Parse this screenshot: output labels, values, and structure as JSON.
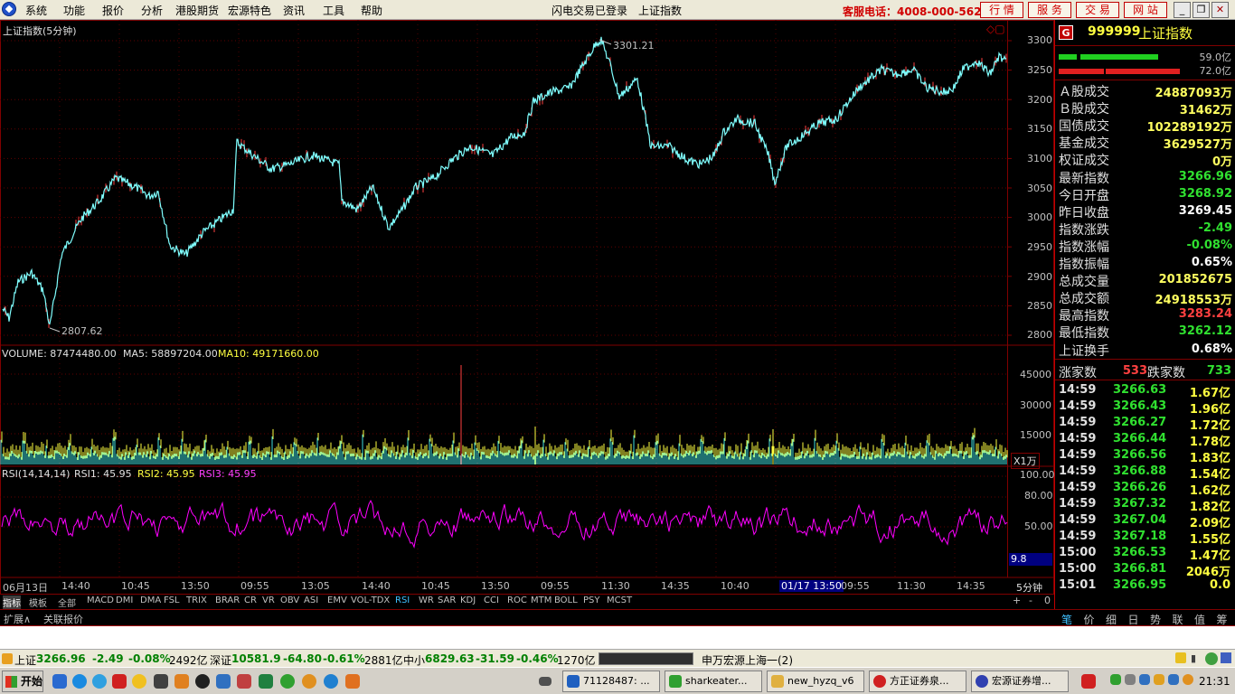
{
  "menubar": {
    "items": [
      "系统",
      "功能",
      "报价",
      "分析",
      "港股期货",
      "宏源特色",
      "资讯",
      "工具",
      "帮助"
    ],
    "status": "闪电交易已登录",
    "index_name": "上证指数",
    "hotline": "客服电话：4008-000-562",
    "buttons": [
      "行 情",
      "服 务",
      "交 易",
      "网 站"
    ]
  },
  "price_panel": {
    "title": "上证指数(5分钟)",
    "high_label": "3301.21",
    "low_label": "2807.62",
    "y_ticks": [
      "3300",
      "3250",
      "3200",
      "3150",
      "3100",
      "3050",
      "3000",
      "2950",
      "2900",
      "2850",
      "2800"
    ]
  },
  "volume_panel": {
    "label": "VOLUME: 87474480.00",
    "ma5": "MA5: 58897204.00",
    "ma10": "MA10: 49171660.00",
    "y_ticks": [
      "45000",
      "30000",
      "15000"
    ],
    "unit": "X1万"
  },
  "rsi_panel": {
    "label": "RSI(14,14,14)",
    "rsi1": "RSI1: 45.95",
    "rsi2": "RSI2: 45.95",
    "rsi3": "RSI3: 45.95",
    "y_ticks": [
      "100.00",
      "80.00",
      "50.00"
    ],
    "current": "9.8"
  },
  "time_axis": {
    "labels": [
      "06月13日",
      "14:40",
      "10:45",
      "13:50",
      "09:55",
      "13:05",
      "14:40",
      "10:45",
      "13:50",
      "09:55",
      "11:30",
      "14:35",
      "10:40",
      "01/17 13:50",
      "09:55",
      "11:30",
      "14:35"
    ],
    "period": "5分钟"
  },
  "indicator_tabs": [
    "指标",
    "模板",
    "全部",
    "MACD",
    "DMI",
    "DMA",
    "FSL",
    "TRIX",
    "BRAR",
    "CR",
    "VR",
    "OBV",
    "ASI",
    "EMV",
    "VOL-TDX",
    "RSI",
    "WR",
    "SAR",
    "KDJ",
    "CCI",
    "ROC",
    "MTM",
    "BOLL",
    "PSY",
    "MCST"
  ],
  "zoom_controls": [
    "+",
    "-",
    "0"
  ],
  "ext_tabs": [
    "扩展∧",
    "关联报价"
  ],
  "stock": {
    "code": "999999",
    "name": "上证指数",
    "badge": "G",
    "up_amount": "59.0亿",
    "down_amount": "72.0亿",
    "rows": [
      {
        "k": "Ａ股成交",
        "v": "24887093万",
        "c": "#ffff60"
      },
      {
        "k": "Ｂ股成交",
        "v": "31462万",
        "c": "#ffff60"
      },
      {
        "k": "国债成交",
        "v": "102289192万",
        "c": "#ffff60"
      },
      {
        "k": "基金成交",
        "v": "3629527万",
        "c": "#ffff60"
      },
      {
        "k": "权证成交",
        "v": "0万",
        "c": "#ffff60"
      },
      {
        "k": "最新指数",
        "v": "3266.96",
        "c": "#30e030"
      },
      {
        "k": "今日开盘",
        "v": "3268.92",
        "c": "#30e030"
      },
      {
        "k": "昨日收盘",
        "v": "3269.45",
        "c": "#ffffff"
      },
      {
        "k": "指数涨跌",
        "v": "-2.49",
        "c": "#30e030"
      },
      {
        "k": "指数涨幅",
        "v": "-0.08%",
        "c": "#30e030"
      },
      {
        "k": "指数振幅",
        "v": "0.65%",
        "c": "#ffffff"
      },
      {
        "k": "总成交量",
        "v": "201852675",
        "c": "#ffff60"
      },
      {
        "k": "总成交额",
        "v": "24918553万",
        "c": "#ffff60"
      },
      {
        "k": "最高指数",
        "v": "3283.24",
        "c": "#ff4040"
      },
      {
        "k": "最低指数",
        "v": "3262.12",
        "c": "#30e030"
      },
      {
        "k": "上证换手",
        "v": "0.68%",
        "c": "#ffffff"
      }
    ],
    "up_label": "涨家数",
    "up_count": "533",
    "down_label": "跌家数",
    "down_count": "733"
  },
  "ticks": [
    {
      "t": "14:59",
      "p": "3266.63",
      "a": "1.67亿"
    },
    {
      "t": "14:59",
      "p": "3266.43",
      "a": "1.96亿"
    },
    {
      "t": "14:59",
      "p": "3266.27",
      "a": "1.72亿"
    },
    {
      "t": "14:59",
      "p": "3266.44",
      "a": "1.78亿"
    },
    {
      "t": "14:59",
      "p": "3266.56",
      "a": "1.83亿"
    },
    {
      "t": "14:59",
      "p": "3266.88",
      "a": "1.54亿"
    },
    {
      "t": "14:59",
      "p": "3266.26",
      "a": "1.62亿"
    },
    {
      "t": "14:59",
      "p": "3267.32",
      "a": "1.82亿"
    },
    {
      "t": "14:59",
      "p": "3267.04",
      "a": "2.09亿"
    },
    {
      "t": "14:59",
      "p": "3267.18",
      "a": "1.55亿"
    },
    {
      "t": "15:00",
      "p": "3266.53",
      "a": "1.47亿"
    },
    {
      "t": "15:00",
      "p": "3266.81",
      "a": "2046万"
    },
    {
      "t": "15:01",
      "p": "3266.95",
      "a": "0.0"
    }
  ],
  "right_tabs": [
    "笔",
    "价",
    "细",
    "日",
    "势",
    "联",
    "值",
    "筹"
  ],
  "statusbar": {
    "sh_name": "上证",
    "sh_val": "3266.96",
    "sh_chg": "-2.49",
    "sh_pct": "-0.08%",
    "sh_amt": "2492亿",
    "sz_name": "深证",
    "sz_val": "10581.9",
    "sz_chg": "-64.80",
    "sz_pct": "-0.61%",
    "sz_amt": "2881亿",
    "zx_name": "中小",
    "zx_val": "6829.63",
    "zx_chg": "-31.59",
    "zx_pct": "-0.46%",
    "zx_amt": "1270亿",
    "server": "申万宏源上海一(2)"
  },
  "taskbar": {
    "start": "开始",
    "items": [
      "71128487: ...",
      "sharkeater...",
      "new_hyzq_v6",
      "方正证券泉...",
      "宏源证券增..."
    ],
    "clock": "21:31"
  },
  "colors": {
    "price_line": "#80ffff",
    "price_up": "#ff4040",
    "rsi_line": "#ff00ff",
    "vol_yellow": "#ffff40",
    "vol_cyan": "#40e0e0",
    "grid": "#800000",
    "axis_text": "#c0c0c0"
  }
}
